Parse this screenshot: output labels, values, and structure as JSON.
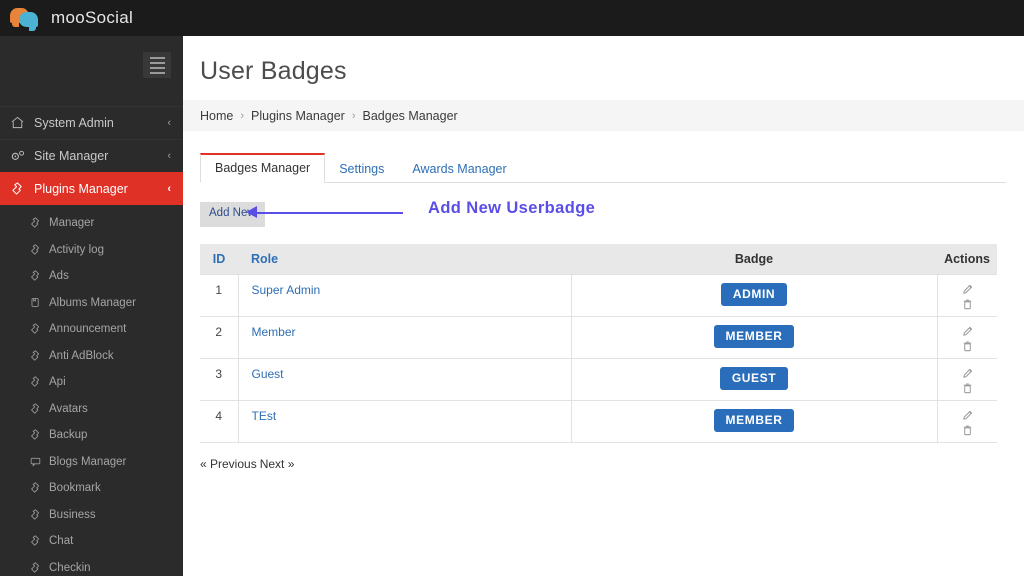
{
  "topbar": {
    "brand": "mooSocial",
    "logo_icon": "chat-bubbles-logo",
    "menu_icon": "hamburger-icon"
  },
  "sidebar": {
    "main_items": [
      {
        "label": "System Admin",
        "icon": "home-icon",
        "chevron": "‹",
        "active": false
      },
      {
        "label": "Site Manager",
        "icon": "gears-icon",
        "chevron": "‹",
        "active": false
      },
      {
        "label": "Plugins Manager",
        "icon": "plug-icon",
        "chevron": "‹",
        "active": true
      }
    ],
    "sub_items": [
      {
        "label": "Manager",
        "icon": "plug-icon"
      },
      {
        "label": "Activity log",
        "icon": "plug-icon"
      },
      {
        "label": "Ads",
        "icon": "plug-icon"
      },
      {
        "label": "Albums Manager",
        "icon": "album-icon"
      },
      {
        "label": "Announcement",
        "icon": "plug-icon"
      },
      {
        "label": "Anti AdBlock",
        "icon": "plug-icon"
      },
      {
        "label": "Api",
        "icon": "plug-icon"
      },
      {
        "label": "Avatars",
        "icon": "plug-icon"
      },
      {
        "label": "Backup",
        "icon": "plug-icon"
      },
      {
        "label": "Blogs Manager",
        "icon": "comment-icon"
      },
      {
        "label": "Bookmark",
        "icon": "plug-icon"
      },
      {
        "label": "Business",
        "icon": "plug-icon"
      },
      {
        "label": "Chat",
        "icon": "plug-icon"
      },
      {
        "label": "Checkin",
        "icon": "plug-icon"
      }
    ]
  },
  "page": {
    "title": "User Badges",
    "breadcrumb": [
      "Home",
      "Plugins Manager",
      "Badges Manager"
    ],
    "breadcrumb_separator": "›"
  },
  "tabs": [
    {
      "label": "Badges Manager",
      "active": true
    },
    {
      "label": "Settings",
      "active": false
    },
    {
      "label": "Awards Manager",
      "active": false
    }
  ],
  "toolbar": {
    "add_new_label": "Add New"
  },
  "annotation": {
    "text": "Add New Userbadge",
    "color": "#5b4ee8"
  },
  "table": {
    "headers": {
      "id": "ID",
      "role": "Role",
      "badge": "Badge",
      "actions": "Actions"
    },
    "rows": [
      {
        "id": "1",
        "role": "Super Admin",
        "badge": "ADMIN",
        "edit_icon": "pencil-icon",
        "delete_icon": "trash-icon"
      },
      {
        "id": "2",
        "role": "Member",
        "badge": "MEMBER",
        "edit_icon": "pencil-icon",
        "delete_icon": "trash-icon"
      },
      {
        "id": "3",
        "role": "Guest",
        "badge": "GUEST",
        "edit_icon": "pencil-icon",
        "delete_icon": "trash-icon"
      },
      {
        "id": "4",
        "role": "TEst",
        "badge": "MEMBER",
        "edit_icon": "pencil-icon",
        "delete_icon": "trash-icon"
      }
    ]
  },
  "pagination": {
    "previous": "« Previous",
    "next": "Next »"
  },
  "colors": {
    "accent_red": "#e03127",
    "badge_blue": "#2a6ebb",
    "link_blue": "#2f6fb5",
    "sidebar_bg": "#2b2b2b",
    "topbar_bg": "#1b1b1b",
    "annotation_purple": "#5b4ee8"
  }
}
